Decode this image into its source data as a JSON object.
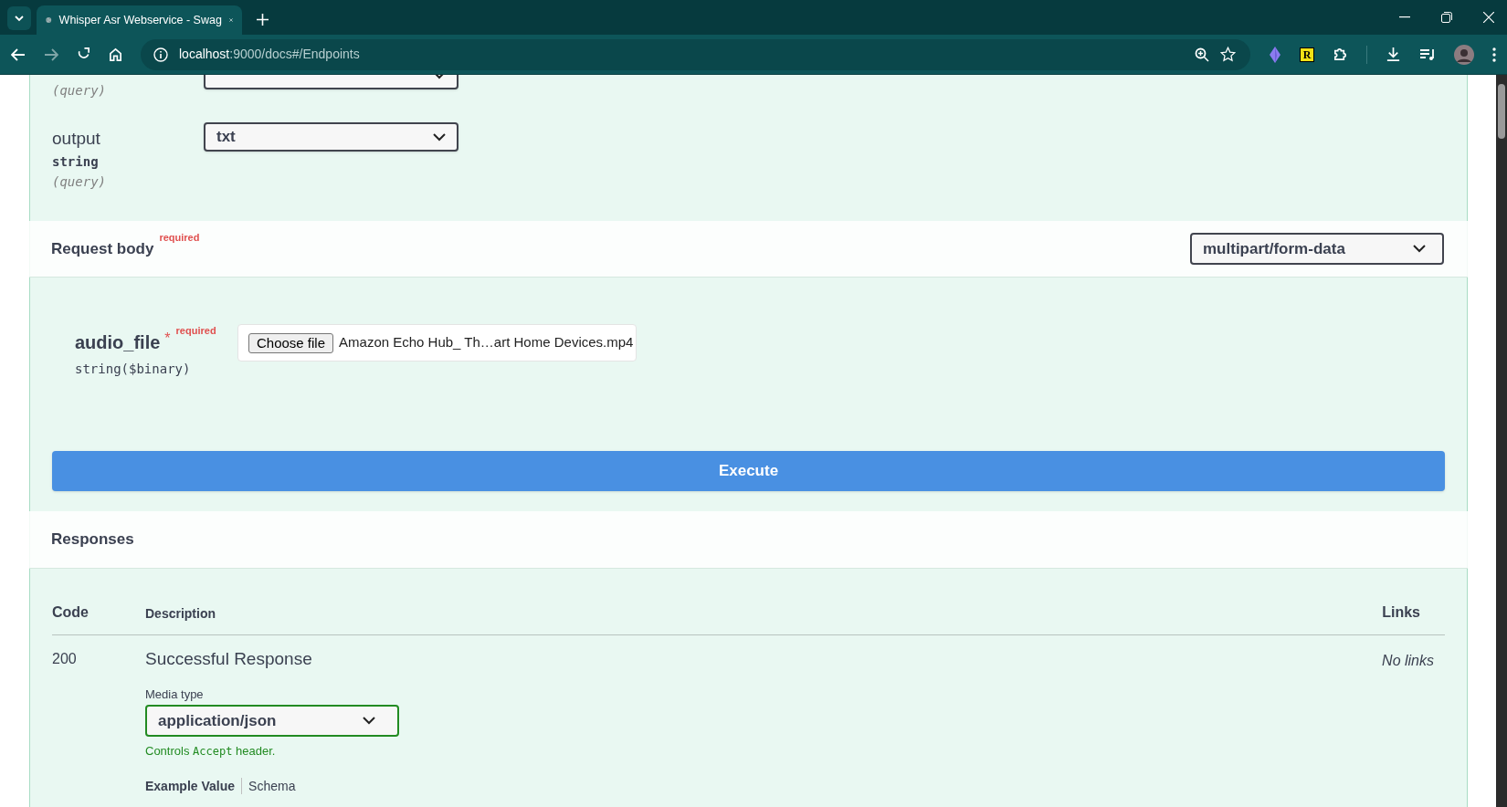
{
  "browser": {
    "tab_title": "Whisper Asr Webservice - Swag",
    "url_host": "localhost",
    "url_path": ":9000/docs#/Endpoints",
    "extension_badge": "R"
  },
  "parameters": [
    {
      "location": "(query)"
    },
    {
      "name": "output",
      "type": "string",
      "location": "(query)",
      "value": "txt"
    }
  ],
  "request_body": {
    "title": "Request body",
    "required_label": "required",
    "content_type": "multipart/form-data",
    "fields": [
      {
        "name": "audio_file",
        "required_mark": "*",
        "required_label": "required",
        "type": "string($binary)",
        "button": "Choose file",
        "file_name": "Amazon Echo Hub_ Th…art Home Devices.mp4"
      }
    ]
  },
  "execute": "Execute",
  "responses": {
    "title": "Responses",
    "columns": [
      "Code",
      "Description",
      "Links"
    ],
    "rows": [
      {
        "code": "200",
        "description": "Successful Response",
        "media_type_label": "Media type",
        "media_type": "application/json",
        "controls_note": {
          "before": "Controls",
          "code": "Accept",
          "after": "header."
        },
        "tabs": [
          {
            "label": "Example Value",
            "selected": true
          },
          {
            "label": "Schema",
            "selected": false
          }
        ],
        "links": "No links"
      }
    ]
  }
}
